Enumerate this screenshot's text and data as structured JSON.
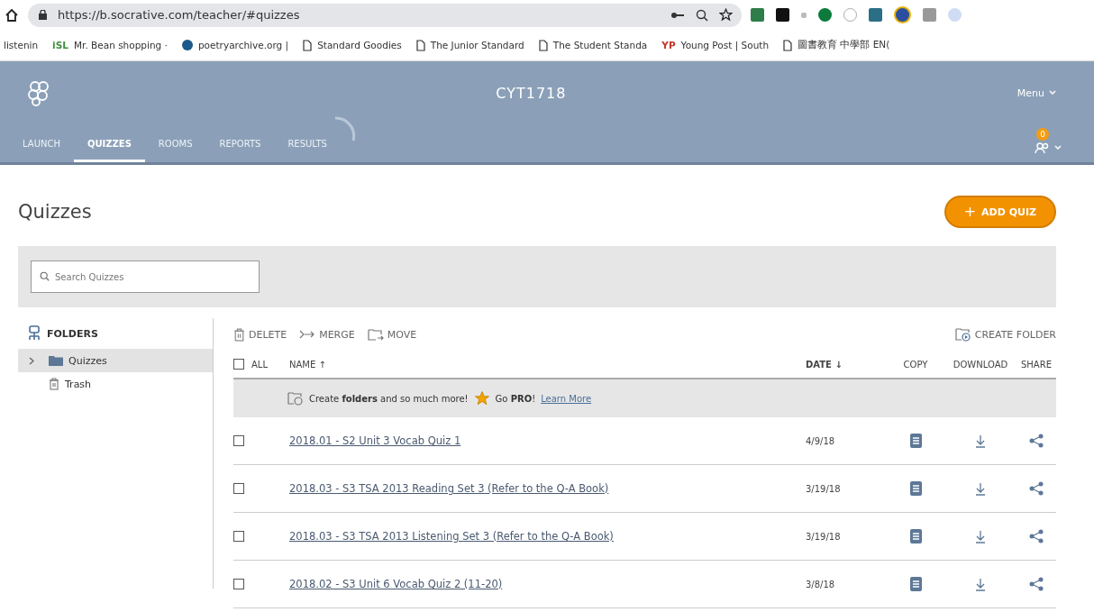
{
  "browser": {
    "url": "https://b.socrative.com/teacher/#quizzes",
    "bookmarks": [
      {
        "label": "listenin",
        "kind": "plain"
      },
      {
        "label": "Mr. Bean shopping ·",
        "kind": "isl"
      },
      {
        "label": "poetryarchive.org |",
        "kind": "dot"
      },
      {
        "label": "Standard Goodies",
        "kind": "page"
      },
      {
        "label": "The Junior Standard",
        "kind": "page"
      },
      {
        "label": "The Student Standa",
        "kind": "page"
      },
      {
        "label": "Young Post | South",
        "kind": "yp"
      },
      {
        "label": "圖書教育 中學部 EN(",
        "kind": "page"
      }
    ],
    "isl_text": "iSL",
    "yp_text": "YP"
  },
  "header": {
    "room": "CYT1718",
    "menu": "Menu",
    "badge": "0",
    "tabs": [
      {
        "label": "LAUNCH",
        "selected": false
      },
      {
        "label": "QUIZZES",
        "selected": true
      },
      {
        "label": "ROOMS",
        "selected": false
      },
      {
        "label": "REPORTS",
        "selected": false
      },
      {
        "label": "RESULTS",
        "selected": false
      }
    ]
  },
  "page_title": "Quizzes",
  "add_button": "ADD QUIZ",
  "add_plus": "+",
  "search": {
    "placeholder": "Search Quizzes"
  },
  "folders": {
    "title": "FOLDERS",
    "items": [
      {
        "label": "Quizzes",
        "kind": "folder",
        "selected": true,
        "expanded": false
      },
      {
        "label": "Trash",
        "kind": "trash",
        "selected": false
      }
    ]
  },
  "toolbar": {
    "actions": [
      {
        "label": "DELETE",
        "kind": "delete"
      },
      {
        "label": "MERGE",
        "kind": "merge"
      },
      {
        "label": "MOVE",
        "kind": "move"
      }
    ],
    "create_folder": "CREATE FOLDER"
  },
  "table": {
    "all_label": "ALL",
    "all_checked": false,
    "columns": [
      "NAME ↑",
      "DATE ↓",
      "COPY",
      "DOWNLOAD",
      "SHARE"
    ],
    "promo": "Create **folders** and so much more!",
    "go_pro": "Go **PRO**!",
    "learn_more": "Learn More",
    "rows": [
      {
        "name": "2018.01 - S2 Unit 3 Vocab Quiz 1",
        "date": "4/9/18",
        "checked": false
      },
      {
        "name": "2018.03 - S3 TSA 2013 Reading Set 3 (Refer to the Q-A Book)",
        "date": "3/19/18",
        "checked": false
      },
      {
        "name": "2018.03 - S3 TSA 2013 Listening Set 3 (Refer to the Q-A Book)",
        "date": "3/19/18",
        "checked": false
      },
      {
        "name": "2018.02 - S3 Unit 6 Vocab Quiz 2 (11-20)",
        "date": "3/8/18",
        "checked": false
      }
    ]
  }
}
